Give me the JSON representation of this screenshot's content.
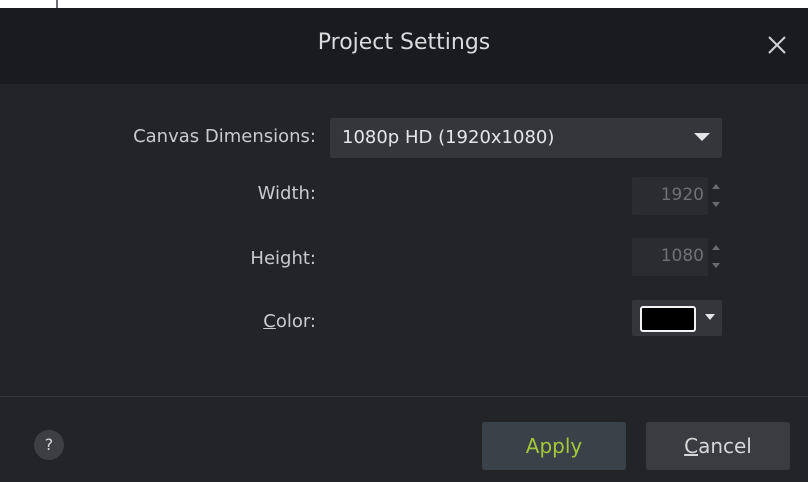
{
  "dialog": {
    "title": "Project Settings"
  },
  "fields": {
    "canvas_dimensions": {
      "label": "Canvas Dimensions:",
      "value": "1080p HD (1920x1080)"
    },
    "width": {
      "label": "Width:",
      "value": "1920"
    },
    "height": {
      "label": "Height:",
      "value": "1080"
    },
    "color": {
      "label_mnemonic": "C",
      "label_rest": "olor:",
      "swatch_color": "#000000"
    }
  },
  "footer": {
    "help_label": "?",
    "apply_label": "Apply",
    "cancel_mnemonic": "C",
    "cancel_rest": "ancel"
  },
  "colors": {
    "apply_text": "#a2c83a",
    "background": "#232428",
    "titlebar": "#1a1b1e"
  },
  "icons": {
    "close": "close-icon",
    "dropdown": "chevron-down-icon",
    "spin_up": "spin-up-icon",
    "spin_down": "spin-down-icon",
    "help": "help-icon"
  }
}
